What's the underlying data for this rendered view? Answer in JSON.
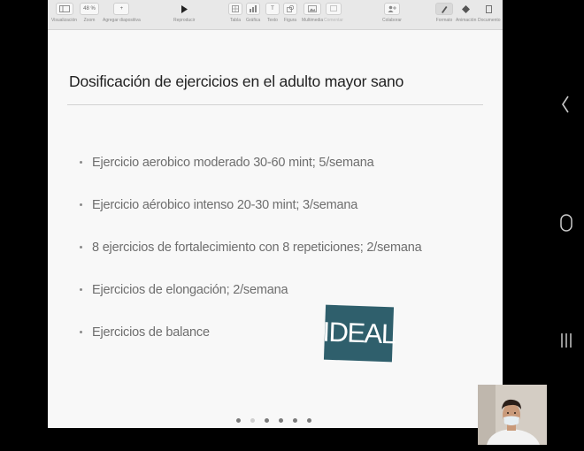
{
  "toolbar": {
    "items": [
      {
        "label": "Visualización",
        "icon": "sidebar-view-icon"
      },
      {
        "label": "Zoom",
        "value": "48 %"
      },
      {
        "label": "Agregar diapositiva",
        "icon": "plus-icon"
      },
      {
        "label": "Reproducir",
        "icon": "play-icon"
      },
      {
        "label": "Tabla",
        "icon": "table-icon"
      },
      {
        "label": "Gráfica",
        "icon": "chart-icon"
      },
      {
        "label": "Texto",
        "icon": "text-icon"
      },
      {
        "label": "Figura",
        "icon": "shape-icon"
      },
      {
        "label": "Multimedia",
        "icon": "media-icon"
      },
      {
        "label": "Comentar",
        "icon": "comment-icon"
      },
      {
        "label": "Colaborar",
        "icon": "collaborate-icon"
      },
      {
        "label": "Formato",
        "icon": "format-brush-icon"
      },
      {
        "label": "Animación",
        "icon": "animation-icon"
      },
      {
        "label": "Documento",
        "icon": "document-icon"
      }
    ]
  },
  "slide": {
    "title": "Dosificación de ejercicios en el adulto mayor sano",
    "bullets": [
      "Ejercicio aerobico moderado 30-60 mint; 5/semana",
      "Ejercicio aérobico intenso 20-30 mint; 3/semana",
      "8 ejercicios de fortalecimiento con 8 repeticiones; 2/semana",
      "Ejercicios de elongación; 2/semana",
      "Ejercicios de balance"
    ],
    "stamp": "IDEAL",
    "stamp_color": "#2f5f6c"
  },
  "navigation": {
    "back_icon": "chevron-left-icon",
    "home_icon": "home-circle-icon",
    "recents_icon": "recents-icon"
  },
  "participant_video": {
    "icon": "participant-video"
  }
}
